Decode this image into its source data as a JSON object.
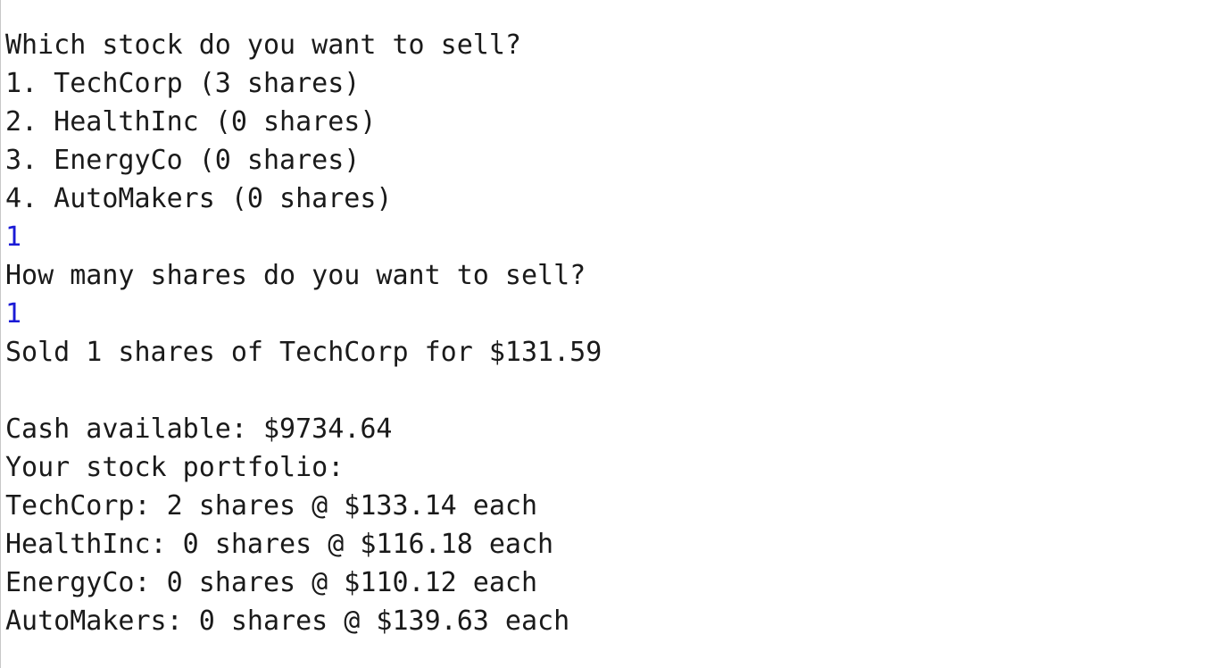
{
  "console": {
    "lines": [
      {
        "text": "Which stock do you want to sell?",
        "kind": "output"
      },
      {
        "text": "1. TechCorp (3 shares)",
        "kind": "output"
      },
      {
        "text": "2. HealthInc (0 shares)",
        "kind": "output"
      },
      {
        "text": "3. EnergyCo (0 shares)",
        "kind": "output"
      },
      {
        "text": "4. AutoMakers (0 shares)",
        "kind": "output"
      },
      {
        "text": "1",
        "kind": "input"
      },
      {
        "text": "How many shares do you want to sell?",
        "kind": "output"
      },
      {
        "text": "1",
        "kind": "input"
      },
      {
        "text": "Sold 1 shares of TechCorp for $131.59",
        "kind": "output"
      },
      {
        "text": "",
        "kind": "output"
      },
      {
        "text": "Cash available: $9734.64",
        "kind": "output"
      },
      {
        "text": "Your stock portfolio:",
        "kind": "output"
      },
      {
        "text": "TechCorp: 2 shares @ $133.14 each",
        "kind": "output"
      },
      {
        "text": "HealthInc: 0 shares @ $116.18 each",
        "kind": "output"
      },
      {
        "text": "EnergyCo: 0 shares @ $110.12 each",
        "kind": "output"
      },
      {
        "text": "AutoMakers: 0 shares @ $139.63 each",
        "kind": "output"
      }
    ]
  },
  "colors": {
    "background": "#ffffff",
    "output_text": "#1a1a1a",
    "input_text": "#1a1ad6"
  }
}
